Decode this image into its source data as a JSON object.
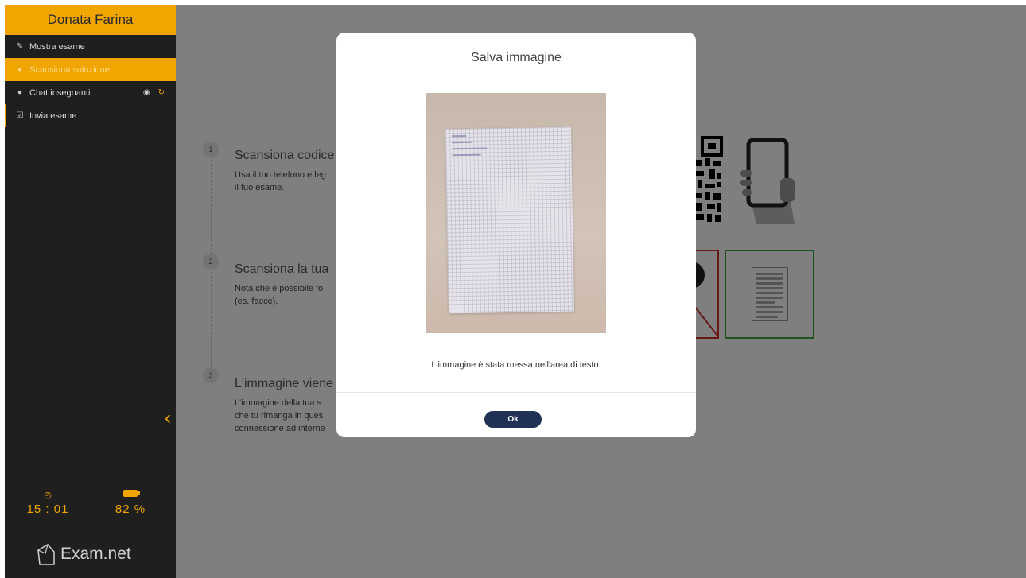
{
  "sidebar": {
    "user_name": "Donata Farina",
    "items": [
      {
        "label": "Mostra esame",
        "icon": "edit-icon"
      },
      {
        "label": "Scansiona soluzione",
        "icon": "camera-icon"
      },
      {
        "label": "Chat insegnanti",
        "icon": "chat-icon"
      },
      {
        "label": "Invia esame",
        "icon": "checkbox-icon"
      }
    ],
    "time": "15 : 01",
    "battery": "82 %",
    "brand": "Exam.net"
  },
  "steps": [
    {
      "num": "1",
      "title": "Scansiona codice",
      "text": "Usa il tuo telefono e leg\nil tuo esame."
    },
    {
      "num": "2",
      "title": "Scansiona la tua",
      "text": "Nota che è possibile fo\n(es. facce)."
    },
    {
      "num": "3",
      "title": "L'immagine viene",
      "text": "L'immagine della tua s\nche tu rimanga in ques\nconnessione ad interne"
    }
  ],
  "modal": {
    "title": "Salva immagine",
    "message": "L'immagine è stata messa nell'area di testo.",
    "ok_label": "Ok"
  },
  "colors": {
    "accent": "#f0a500",
    "sidebar_bg": "#1f1f1f",
    "button_bg": "#203156"
  }
}
